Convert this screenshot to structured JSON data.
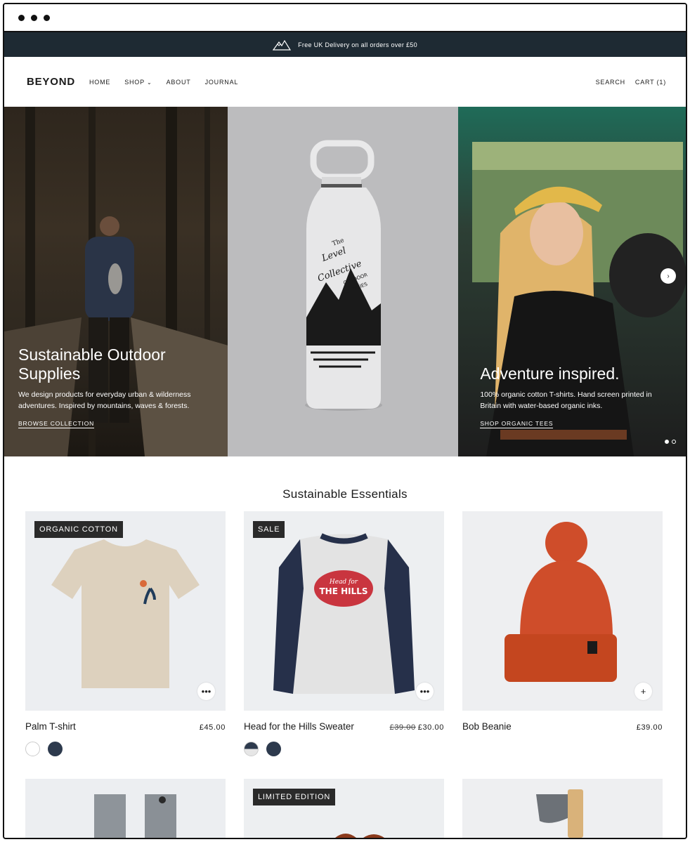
{
  "announcement": {
    "text": "Free UK Delivery on all orders over £50"
  },
  "header": {
    "logo": "BEYOND",
    "nav": [
      "HOME",
      "SHOP",
      "ABOUT",
      "JOURNAL"
    ],
    "search_label": "SEARCH",
    "cart_label": "CART (1)"
  },
  "hero": {
    "left": {
      "title_line1": "Sustainable Outdoor",
      "title_line2": "Supplies",
      "body": "We design products for everyday urban & wilderness adventures. Inspired by mountains, waves & forests.",
      "link": "BROWSE COLLECTION"
    },
    "bottle": {
      "text_line1": "The",
      "text_line2": "Level",
      "text_line3": "Collective",
      "text_line4": "OUTDOOR",
      "text_line5": "SUPPLIES"
    },
    "right": {
      "title": "Adventure inspired.",
      "body": "100% organic cotton T-shirts. Hand screen printed in Britain with water-based organic inks.",
      "link": "SHOP ORGANIC TEES"
    }
  },
  "section": {
    "title": "Sustainable Essentials"
  },
  "products": [
    {
      "badge": "ORGANIC COTTON",
      "name": "Palm T-shirt",
      "price": "£45.00",
      "old_price": "",
      "quick_icon": "ellipsis-icon",
      "quick": "•••",
      "swatch_colors": [
        "#ffffff",
        "#2d3a4d"
      ]
    },
    {
      "badge": "SALE",
      "name": "Head for the Hills Sweater",
      "price": "£30.00",
      "old_price": "£39.00",
      "quick_icon": "ellipsis-icon",
      "quick": "•••",
      "swatch_colors": [
        "split",
        "#2d3a4d"
      ]
    },
    {
      "badge": "",
      "name": "Bob Beanie",
      "price": "£39.00",
      "old_price": "",
      "quick_icon": "plus-icon",
      "quick": "+",
      "swatch_colors": []
    }
  ],
  "products_row2": [
    {
      "badge": ""
    },
    {
      "badge": "LIMITED EDITION"
    },
    {
      "badge": ""
    }
  ],
  "sweater_print": {
    "line1": "Head for",
    "line2": "THE HILLS"
  },
  "colors": {
    "announcement_bg": "#1e2a33",
    "badge_bg": "#2a2a2a",
    "navy": "#2d3a4d",
    "beanie": "#cf4d2a"
  }
}
